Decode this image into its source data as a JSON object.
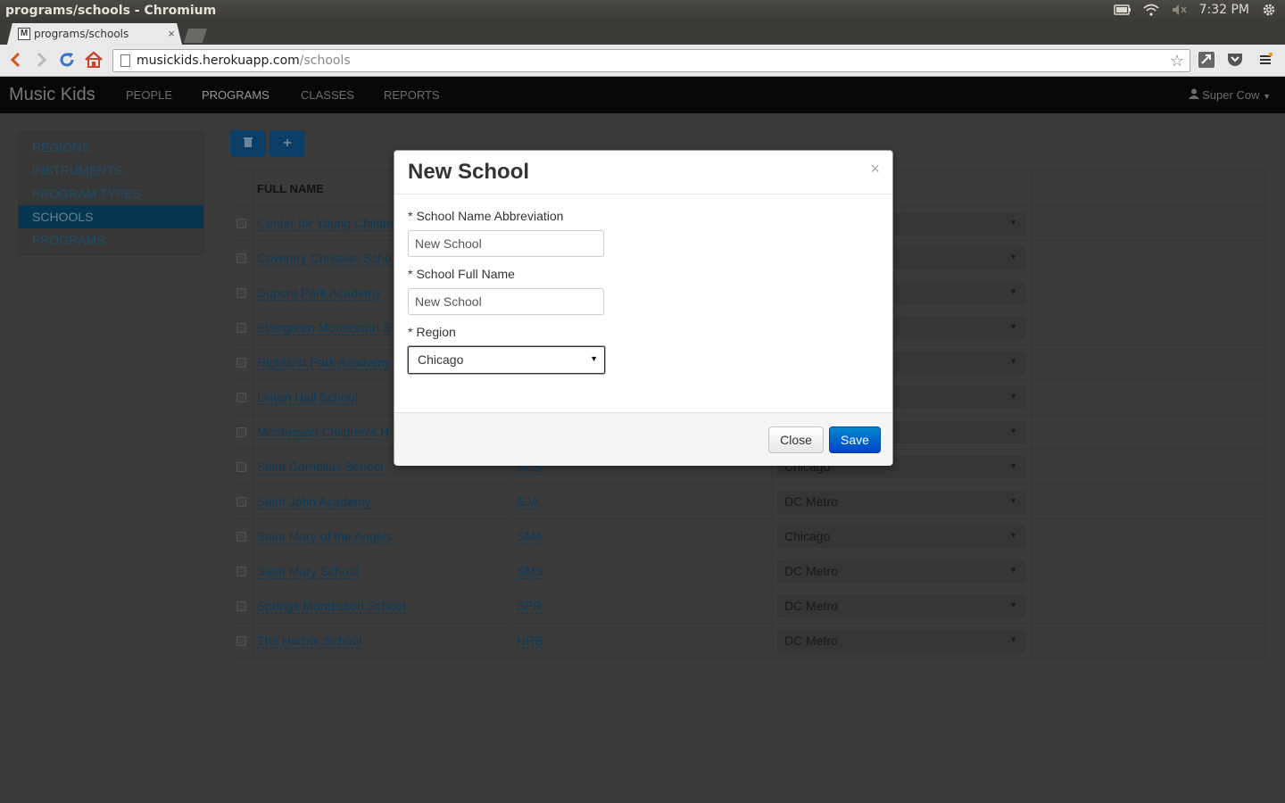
{
  "os": {
    "window_title": "programs/schools - Chromium",
    "clock": "7:32 PM",
    "tray_icons": [
      "battery-icon",
      "wifi-icon",
      "volume-muted-icon",
      "settings-gear-icon"
    ]
  },
  "browser": {
    "tab_title": "programs/schools",
    "tab_favicon": "M",
    "tab_close": "×",
    "url_host": "musickids.herokuapp.com",
    "url_path": "/schools"
  },
  "navbar": {
    "brand": "Music Kids",
    "items": [
      {
        "label": "PEOPLE",
        "active": false
      },
      {
        "label": "PROGRAMS",
        "active": true
      },
      {
        "label": "CLASSES",
        "active": false
      },
      {
        "label": "REPORTS",
        "active": false
      }
    ],
    "user": "Super Cow"
  },
  "sidebar": {
    "items": [
      {
        "label": "REGIONS",
        "active": false
      },
      {
        "label": "INSTRUMENTS",
        "active": false
      },
      {
        "label": "PROGRAM TYPES",
        "active": false
      },
      {
        "label": "SCHOOLS",
        "active": true
      },
      {
        "label": "PROGRAMS",
        "active": false
      }
    ]
  },
  "actions": {
    "delete_icon": "trash-icon",
    "add_label": "+"
  },
  "table": {
    "headers": [
      "FULL NAME"
    ],
    "rows": [
      {
        "name": "Center for Young Childre",
        "abbr": "",
        "region": ""
      },
      {
        "name": "Coventry Christian Scho",
        "abbr": "",
        "region": ""
      },
      {
        "name": "Dupont Park Academy",
        "abbr": "",
        "region": ""
      },
      {
        "name": "Evergreen Montessori S",
        "abbr": "",
        "region": ""
      },
      {
        "name": "Highland Park Academy",
        "abbr": "",
        "region": ""
      },
      {
        "name": "Linton Hall School",
        "abbr": "",
        "region": ""
      },
      {
        "name": "Montessori Children's H",
        "abbr": "",
        "region": ""
      },
      {
        "name": "Saint Cornelius School",
        "abbr": "SCS",
        "region": "Chicago"
      },
      {
        "name": "Saint John Academy",
        "abbr": "SJA",
        "region": "DC Metro"
      },
      {
        "name": "Saint Mary of the Angels",
        "abbr": "SMA",
        "region": "Chicago"
      },
      {
        "name": "Saint Mary School",
        "abbr": "SMS",
        "region": "DC Metro"
      },
      {
        "name": "Springs Montessori School",
        "abbr": "SPR",
        "region": "DC Metro"
      },
      {
        "name": "The Harbor School",
        "abbr": "HRB",
        "region": "DC Metro"
      }
    ]
  },
  "modal": {
    "title": "New School",
    "close_glyph": "×",
    "required_mark": "*",
    "abbr_label": "School Name Abbreviation",
    "abbr_value": "New School",
    "full_label": "School Full Name",
    "full_value": "New School",
    "region_label": "Region",
    "region_value": "Chicago",
    "close_button": "Close",
    "save_button": "Save"
  },
  "colors": {
    "primary": "#0066cc",
    "navbar": "#080808"
  }
}
